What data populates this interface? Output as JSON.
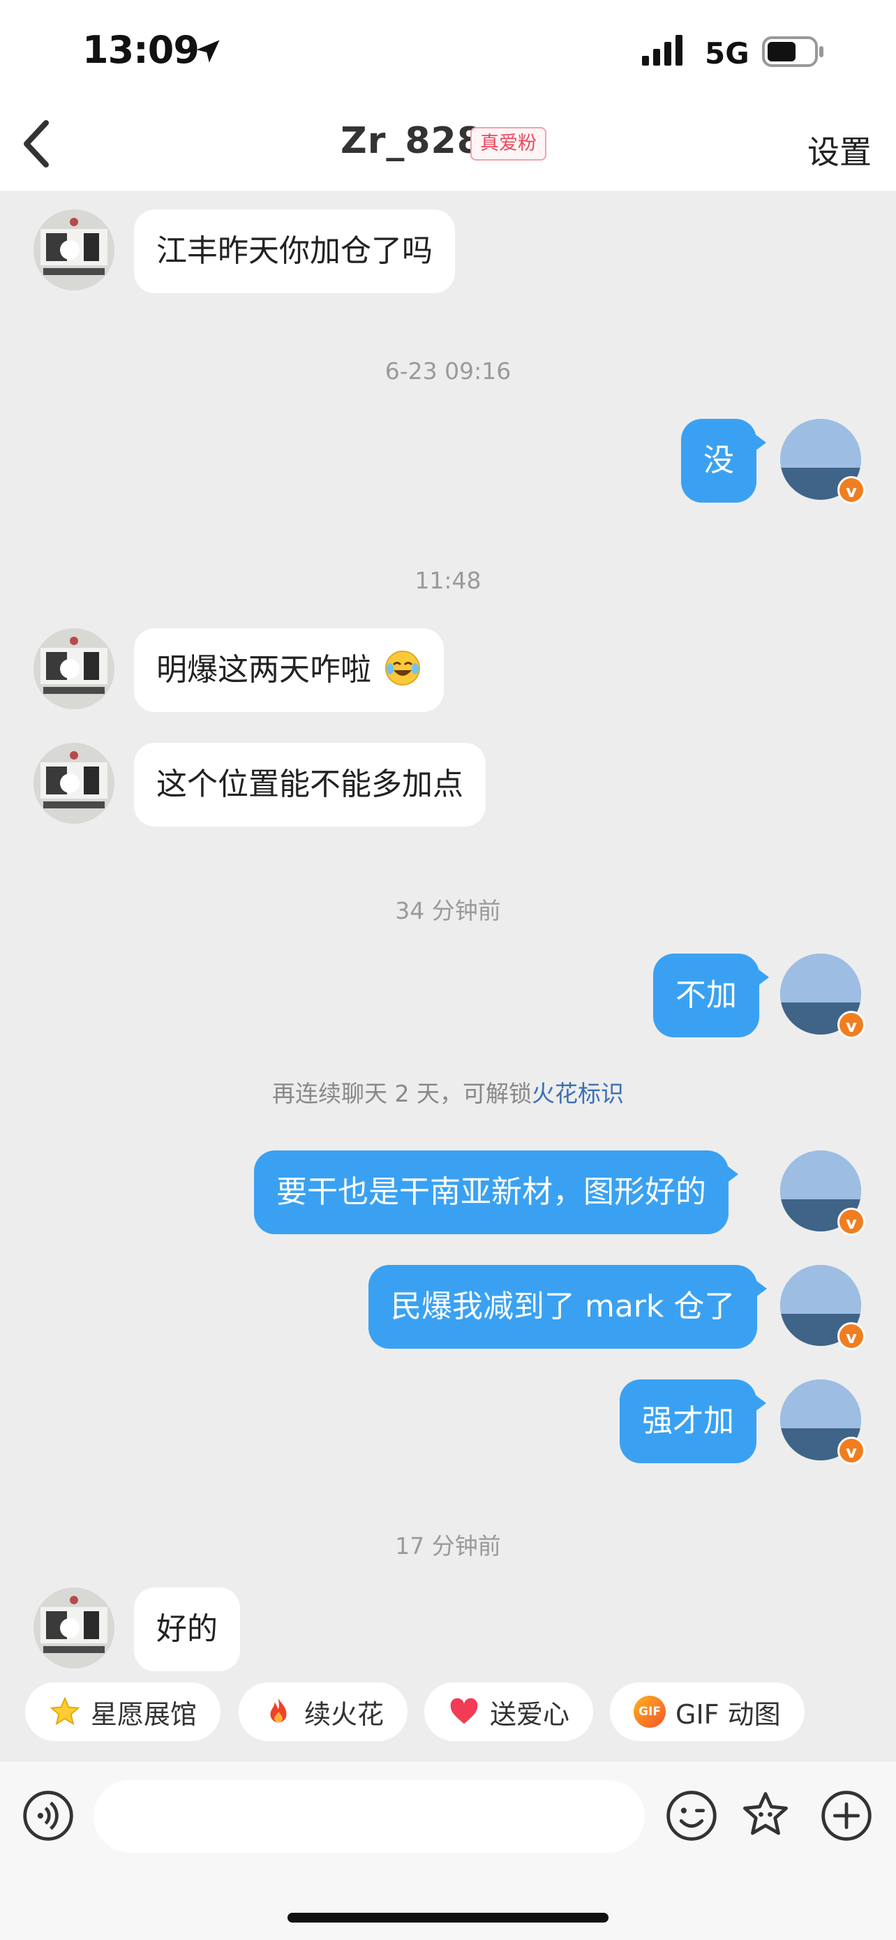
{
  "status_bar": {
    "time": "13:09",
    "network": "5G"
  },
  "header": {
    "title": "Zr_828",
    "badge": "真爱粉",
    "settings": "设置"
  },
  "messages": [
    {
      "from": "other",
      "text": "江丰昨天你加仓了吗"
    },
    {
      "timestamp": "6-23 09:16"
    },
    {
      "from": "self",
      "text": "没"
    },
    {
      "timestamp": "11:48"
    },
    {
      "from": "other",
      "text": "明爆这两天咋啦"
    },
    {
      "from": "other",
      "text": "这个位置能不能多加点"
    },
    {
      "timestamp": "34 分钟前"
    },
    {
      "from": "self",
      "text": "不加"
    },
    {
      "notice": "再连续聊天 2 天，可解锁",
      "notice_link": "火花标识"
    },
    {
      "from": "self",
      "text": "要干也是干南亚新材，图形好的"
    },
    {
      "from": "self",
      "text": "民爆我减到了 mark 仓了"
    },
    {
      "from": "self",
      "text": "强才加"
    },
    {
      "timestamp": "17 分钟前"
    },
    {
      "from": "other",
      "text": "好的"
    }
  ],
  "badge_symbol": "v",
  "quick_actions": [
    {
      "label": "星愿展馆",
      "icon": "star-icon"
    },
    {
      "label": "续火花",
      "icon": "fire-icon"
    },
    {
      "label": "送爱心",
      "icon": "heart-icon"
    },
    {
      "label": "GIF 动图",
      "icon": "gif-icon",
      "icon_text": "GIF"
    }
  ],
  "composer": {
    "placeholder": "",
    "tools": [
      "voice-icon",
      "emoji-icon",
      "sticker-icon",
      "add-icon"
    ]
  },
  "colors": {
    "self_bubble": "#3aa1f2",
    "background": "#ededed",
    "badge": "#f07e20",
    "link": "#3b6fb6"
  }
}
